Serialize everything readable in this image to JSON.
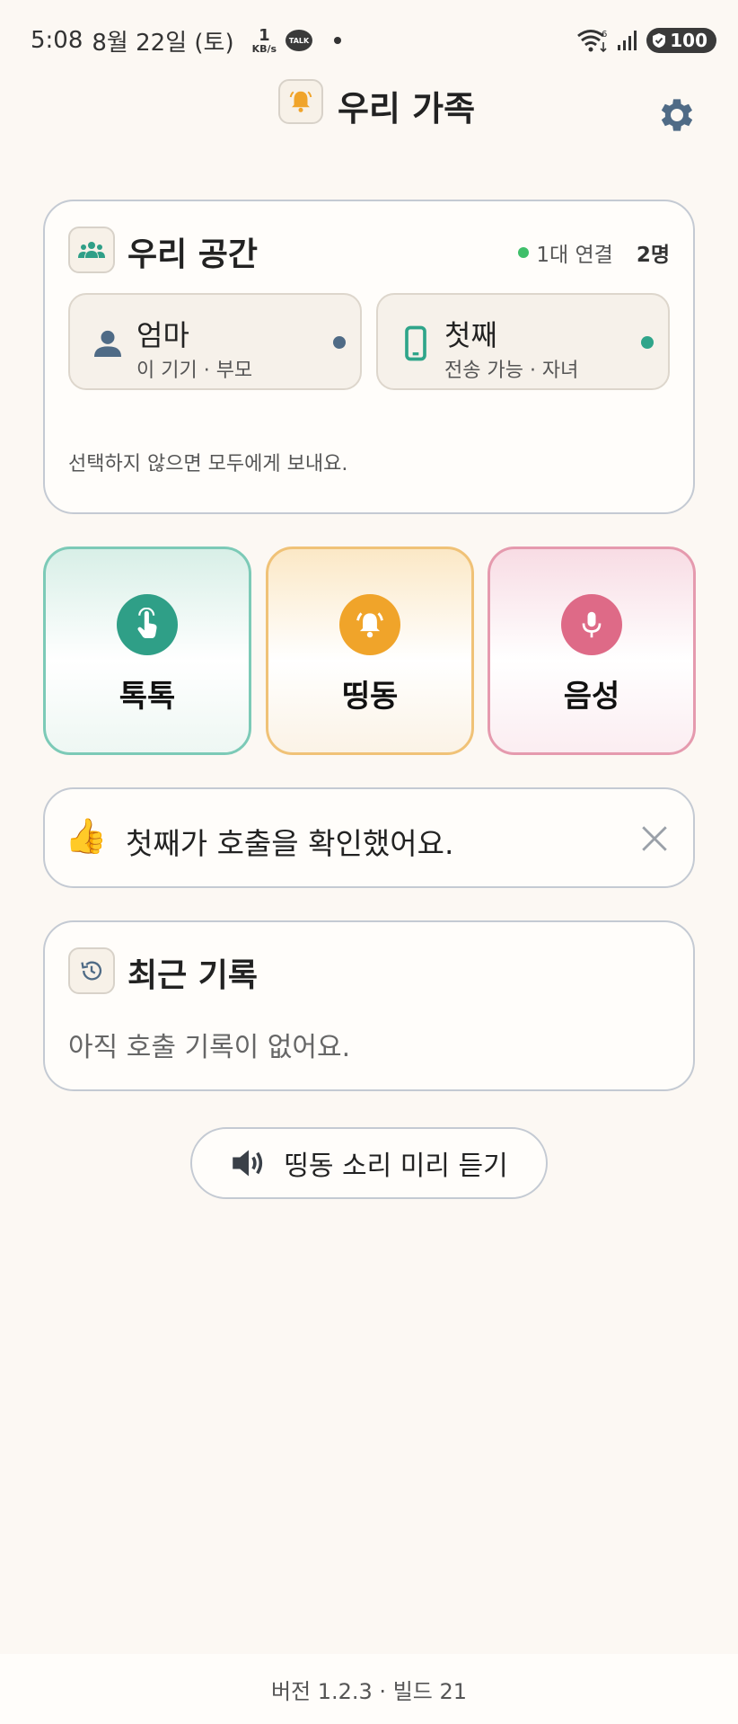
{
  "status_bar": {
    "time": "5:08",
    "date": "8월 22일 (토)",
    "net_speed_value": "1",
    "net_speed_unit": "KB/s",
    "talk_badge": "TALK",
    "wifi_generation": "6",
    "battery": "100"
  },
  "header": {
    "title": "우리 가족",
    "icon": "bell-icon",
    "settings_icon": "gear-icon"
  },
  "space": {
    "title": "우리 공간",
    "connection_status": "1대 연결",
    "member_count": "2명",
    "members": [
      {
        "name": "엄마",
        "subtitle": "이 기기 · 부모",
        "icon": "person-icon",
        "dot_color": "#4f6b86"
      },
      {
        "name": "첫째",
        "subtitle": "전송 가능 · 자녀",
        "icon": "phone-icon",
        "dot_color": "#2fa58a"
      }
    ],
    "note": "선택하지 않으면 모두에게 보내요."
  },
  "actions": [
    {
      "label": "톡톡",
      "icon": "tap-hand-icon",
      "color": "#2f9f87"
    },
    {
      "label": "띵동",
      "icon": "bell-ring-icon",
      "color": "#f0a42a"
    },
    {
      "label": "음성",
      "icon": "microphone-icon",
      "color": "#de6a87"
    }
  ],
  "notice": {
    "emoji": "👍",
    "message": "첫째가 호출을 확인했어요."
  },
  "recent": {
    "title": "최근 기록",
    "empty_text": "아직 호출 기록이 없어요."
  },
  "preview_button": {
    "label": "띵동 소리 미리 듣기",
    "icon": "speaker-icon"
  },
  "footer": {
    "version": "버전 1.2.3 · 빌드 21"
  },
  "colors": {
    "background": "#fcf8f3",
    "teal": "#2f9f87",
    "amber": "#f0a42a",
    "pink": "#de6a87",
    "slate": "#4f6b86"
  }
}
